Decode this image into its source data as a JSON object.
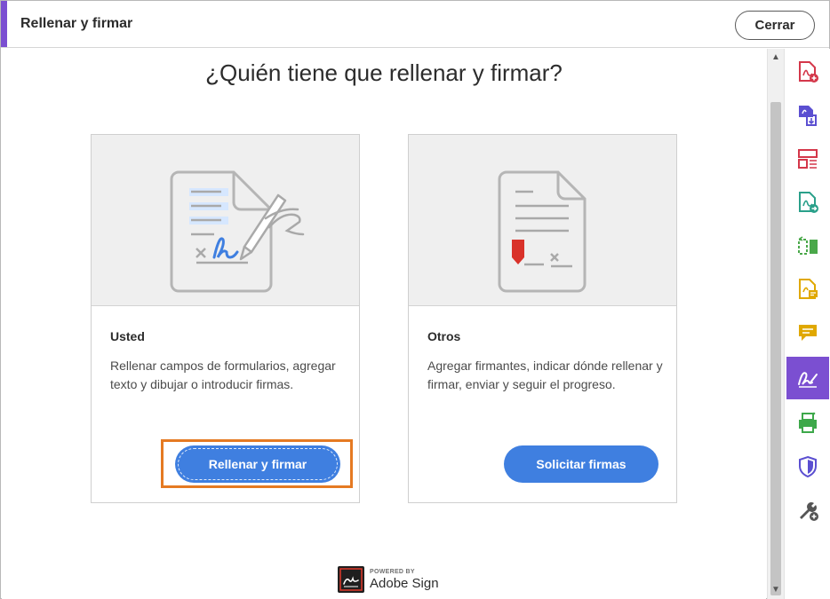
{
  "header": {
    "title": "Rellenar y firmar",
    "close_label": "Cerrar",
    "accent_color": "#7b4fd1"
  },
  "main": {
    "heading": "¿Quién tiene que rellenar y firmar?",
    "cards": [
      {
        "title": "Usted",
        "description": "Rellenar campos de formularios, agregar texto y dibujar o introducir firmas.",
        "button_label": "Rellenar y firmar",
        "illustration": "fill-sign-document-icon"
      },
      {
        "title": "Otros",
        "description": "Agregar firmantes, indicar dónde rellenar y firmar, enviar y seguir el progreso.",
        "button_label": "Solicitar firmas",
        "illustration": "request-signature-document-icon"
      }
    ],
    "button_color": "#3f7fe0",
    "focus_color": "#e57a22"
  },
  "footer": {
    "powered_by": "POWERED BY",
    "brand": "Adobe Sign"
  },
  "tools": [
    {
      "name": "create-pdf-icon",
      "color": "#d4374a"
    },
    {
      "name": "export-pdf-icon",
      "color": "#5b4fd1"
    },
    {
      "name": "organize-pages-icon",
      "color": "#d4374a"
    },
    {
      "name": "edit-pdf-icon",
      "color": "#2aa08a"
    },
    {
      "name": "compare-icon",
      "color": "#4aa84a"
    },
    {
      "name": "comment-file-icon",
      "color": "#e0a800"
    },
    {
      "name": "comment-icon",
      "color": "#e0a800"
    },
    {
      "name": "fill-sign-icon",
      "color": "#ffffff",
      "active": true
    },
    {
      "name": "print-production-icon",
      "color": "#3da84a"
    },
    {
      "name": "protect-icon",
      "color": "#5b4fd1"
    },
    {
      "name": "more-tools-icon",
      "color": "#555555"
    }
  ]
}
